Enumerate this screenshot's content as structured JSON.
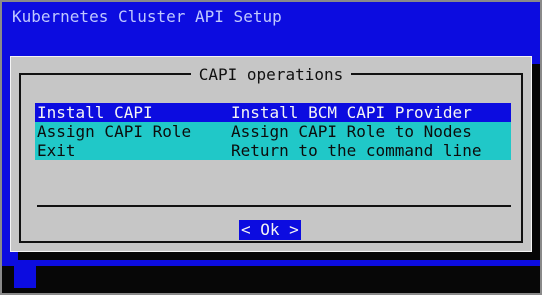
{
  "backtitle": "Kubernetes Cluster API Setup",
  "dialog": {
    "title": "CAPI operations",
    "menu": [
      {
        "tag": "Install CAPI",
        "description": "Install BCM CAPI Provider",
        "selected": true
      },
      {
        "tag": "Assign CAPI Role",
        "description": "Assign CAPI Role to Nodes",
        "selected": false
      },
      {
        "tag": "Exit",
        "description": "Return to the command line",
        "selected": false
      }
    ],
    "ok_label": "< Ok >"
  },
  "colors": {
    "background_blue": "#0c0ce0",
    "dialog_gray": "#c6c6c6",
    "menu_cyan": "#20c8c8",
    "selected_blue": "#0c0ce0"
  }
}
